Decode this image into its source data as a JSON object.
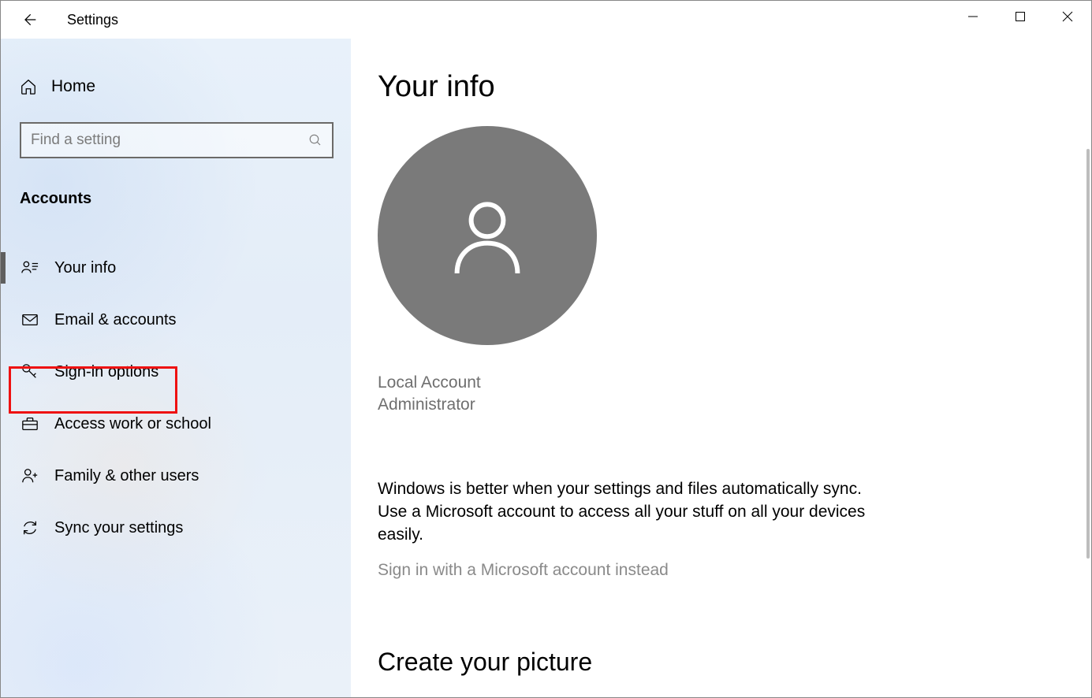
{
  "window": {
    "title": "Settings"
  },
  "sidebar": {
    "home_label": "Home",
    "search_placeholder": "Find a setting",
    "section_header": "Accounts",
    "items": [
      {
        "label": "Your info",
        "icon": "person-list-icon",
        "active": true
      },
      {
        "label": "Email & accounts",
        "icon": "mail-icon",
        "active": false
      },
      {
        "label": "Sign-in options",
        "icon": "key-icon",
        "active": false,
        "highlighted": true
      },
      {
        "label": "Access work or school",
        "icon": "briefcase-icon",
        "active": false
      },
      {
        "label": "Family & other users",
        "icon": "person-plus-icon",
        "active": false
      },
      {
        "label": "Sync your settings",
        "icon": "sync-icon",
        "active": false
      }
    ]
  },
  "main": {
    "page_title": "Your info",
    "account_type": "Local Account",
    "account_role": "Administrator",
    "sync_blurb": "Windows is better when your settings and files automatically sync. Use a Microsoft account to access all your stuff on all your devices easily.",
    "ms_link": "Sign in with a Microsoft account instead",
    "create_picture_heading": "Create your picture"
  }
}
